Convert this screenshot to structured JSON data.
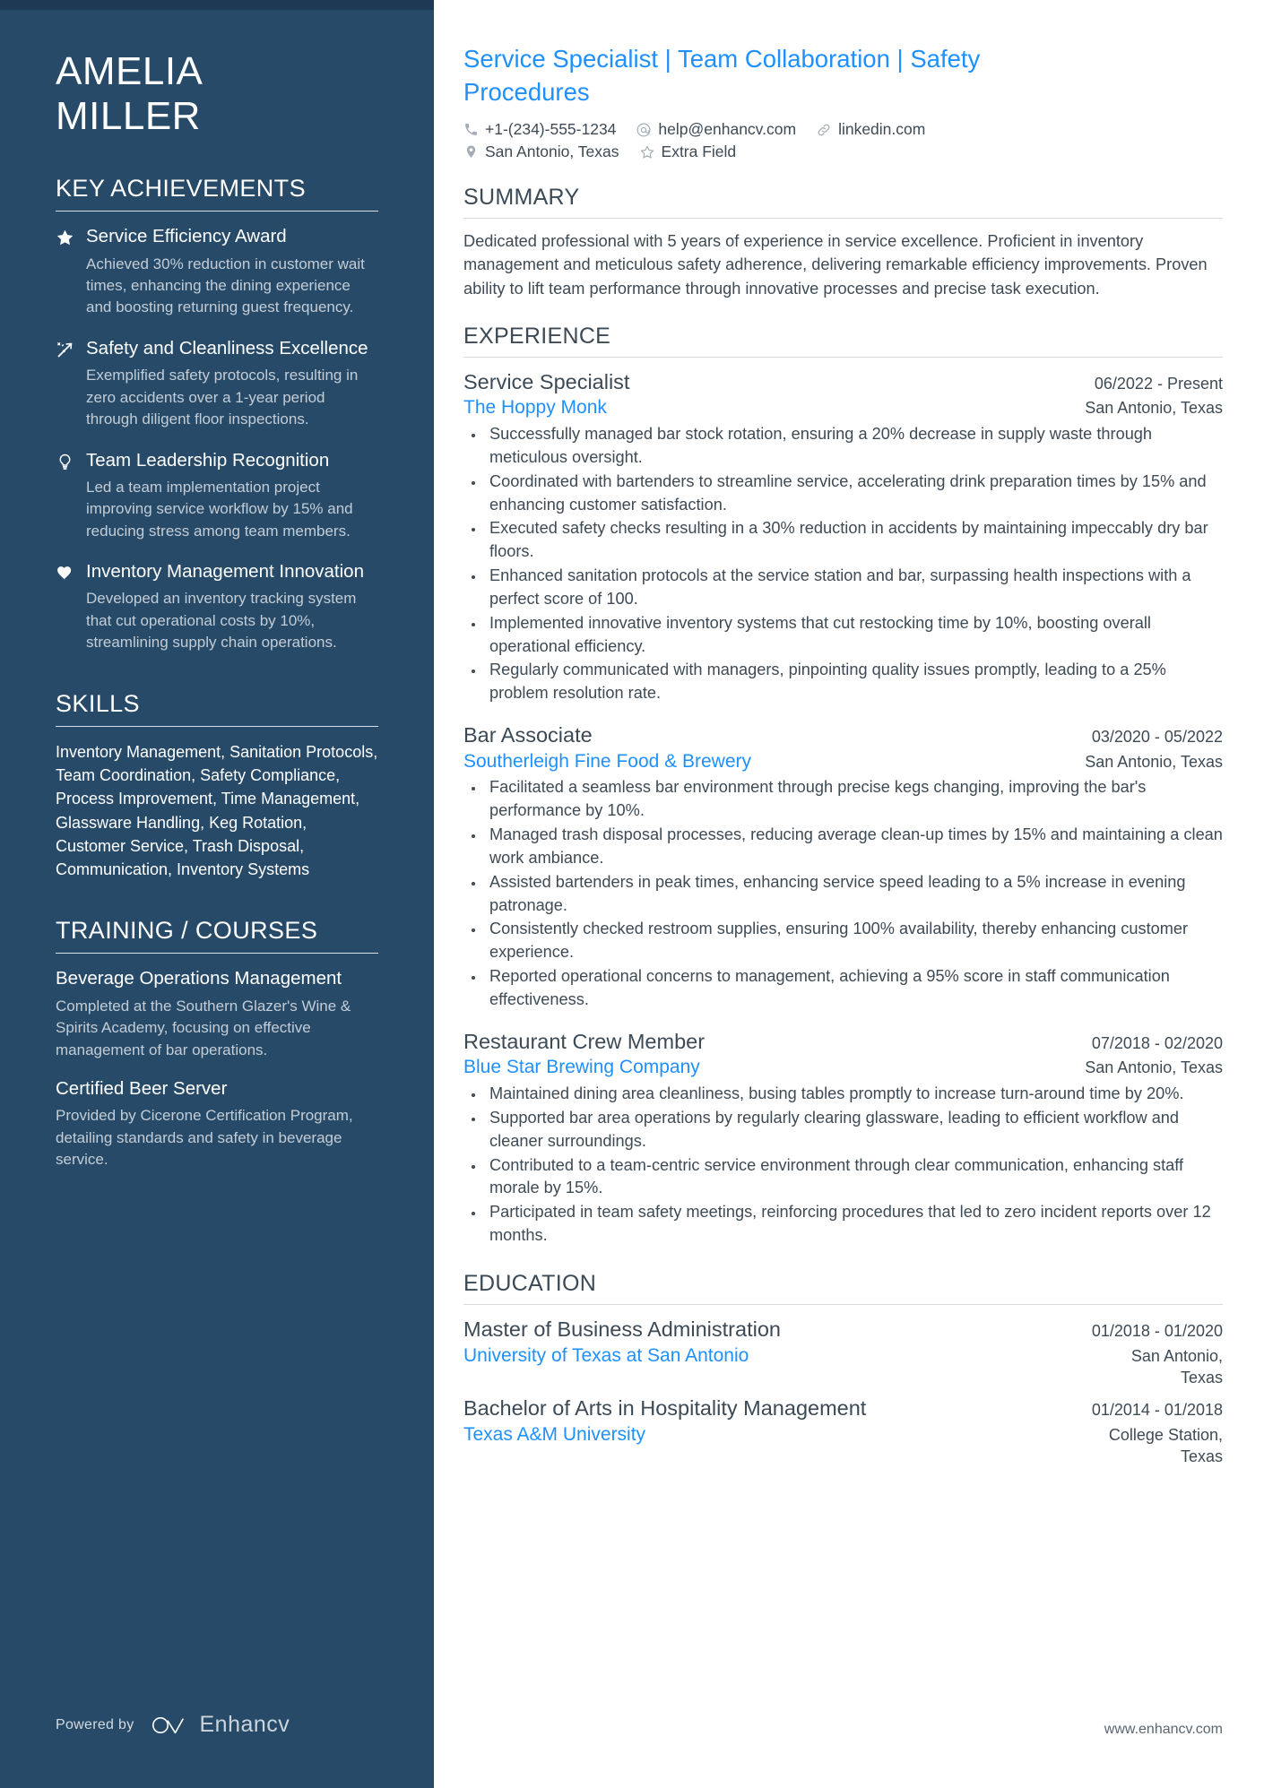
{
  "sidebar": {
    "name_lines": [
      "AMELIA",
      "MILLER"
    ],
    "key_achievements": {
      "heading": "KEY ACHIEVEMENTS",
      "items": [
        {
          "icon": "star-icon",
          "title": "Service Efficiency Award",
          "description": "Achieved 30% reduction in customer wait times, enhancing the dining experience and boosting returning guest frequency."
        },
        {
          "icon": "shooting-star-icon",
          "title": "Safety and Cleanliness Excellence",
          "description": "Exemplified safety protocols, resulting in zero accidents over a 1-year period through diligent floor inspections."
        },
        {
          "icon": "lightbulb-icon",
          "title": "Team Leadership Recognition",
          "description": "Led a team implementation project improving service workflow by 15% and reducing stress among team members."
        },
        {
          "icon": "heart-icon",
          "title": "Inventory Management Innovation",
          "description": "Developed an inventory tracking system that cut operational costs by 10%, streamlining supply chain operations."
        }
      ]
    },
    "skills": {
      "heading": "SKILLS",
      "text": "Inventory Management, Sanitation Protocols, Team Coordination, Safety Compliance, Process Improvement, Time Management, Glassware Handling, Keg Rotation, Customer Service, Trash Disposal, Communication, Inventory Systems"
    },
    "training": {
      "heading": "TRAINING / COURSES",
      "items": [
        {
          "title": "Beverage Operations Management",
          "description": "Completed at the Southern Glazer's Wine & Spirits Academy, focusing on effective management of bar operations."
        },
        {
          "title": "Certified Beer Server",
          "description": "Provided by Cicerone Certification Program, detailing standards and safety in beverage service."
        }
      ]
    },
    "footer": {
      "powered_by": "Powered by",
      "brand": "Enhancv"
    }
  },
  "main": {
    "headline": "Service Specialist | Team Collaboration | Safety Procedures",
    "contact": [
      {
        "icon": "phone-icon",
        "text": "+1-(234)-555-1234"
      },
      {
        "icon": "email-icon",
        "text": "help@enhancv.com"
      },
      {
        "icon": "link-icon",
        "text": "linkedin.com"
      },
      {
        "icon": "location-icon",
        "text": "San Antonio, Texas"
      },
      {
        "icon": "star-outline-icon",
        "text": "Extra Field"
      }
    ],
    "summary": {
      "heading": "SUMMARY",
      "text": "Dedicated professional with 5 years of experience in service excellence. Proficient in inventory management and meticulous safety adherence, delivering remarkable efficiency improvements. Proven ability to lift team performance through innovative processes and precise task execution."
    },
    "experience": {
      "heading": "EXPERIENCE",
      "jobs": [
        {
          "title": "Service Specialist",
          "date": "06/2022 - Present",
          "company": "The Hoppy Monk",
          "location": "San Antonio, Texas",
          "bullets": [
            "Successfully managed bar stock rotation, ensuring a 20% decrease in supply waste through meticulous oversight.",
            "Coordinated with bartenders to streamline service, accelerating drink preparation times by 15% and enhancing customer satisfaction.",
            "Executed safety checks resulting in a 30% reduction in accidents by maintaining impeccably dry bar floors.",
            "Enhanced sanitation protocols at the service station and bar, surpassing health inspections with a perfect score of 100.",
            "Implemented innovative inventory systems that cut restocking time by 10%, boosting overall operational efficiency.",
            "Regularly communicated with managers, pinpointing quality issues promptly, leading to a 25% problem resolution rate."
          ]
        },
        {
          "title": "Bar Associate",
          "date": "03/2020 - 05/2022",
          "company": "Southerleigh Fine Food & Brewery",
          "location": "San Antonio, Texas",
          "bullets": [
            "Facilitated a seamless bar environment through precise kegs changing, improving the bar's performance by 10%.",
            "Managed trash disposal processes, reducing average clean-up times by 15% and maintaining a clean work ambiance.",
            "Assisted bartenders in peak times, enhancing service speed leading to a 5% increase in evening patronage.",
            "Consistently checked restroom supplies, ensuring 100% availability, thereby enhancing customer experience.",
            "Reported operational concerns to management, achieving a 95% score in staff communication effectiveness."
          ]
        },
        {
          "title": "Restaurant Crew Member",
          "date": "07/2018 - 02/2020",
          "company": "Blue Star Brewing Company",
          "location": "San Antonio, Texas",
          "bullets": [
            "Maintained dining area cleanliness, busing tables promptly to increase turn-around time by 20%.",
            "Supported bar area operations by regularly clearing glassware, leading to efficient workflow and cleaner surroundings.",
            "Contributed to a team-centric service environment through clear communication, enhancing staff morale by 15%.",
            "Participated in team safety meetings, reinforcing procedures that led to zero incident reports over 12 months."
          ]
        }
      ]
    },
    "education": {
      "heading": "EDUCATION",
      "entries": [
        {
          "degree": "Master of Business Administration",
          "date": "01/2018 - 01/2020",
          "school": "University of Texas at San Antonio",
          "location": "San Antonio, Texas"
        },
        {
          "degree": "Bachelor of Arts in Hospitality Management",
          "date": "01/2014 - 01/2018",
          "school": "Texas A&M University",
          "location": "College Station, Texas"
        }
      ]
    },
    "footer_url": "www.enhancv.com"
  },
  "colors": {
    "sidebar_bg": "#264a68",
    "sidebar_topbar": "#1d3954",
    "accent_blue": "#1e90ff",
    "heading_slate": "#3c4a56",
    "body_text": "#3e4a54"
  }
}
